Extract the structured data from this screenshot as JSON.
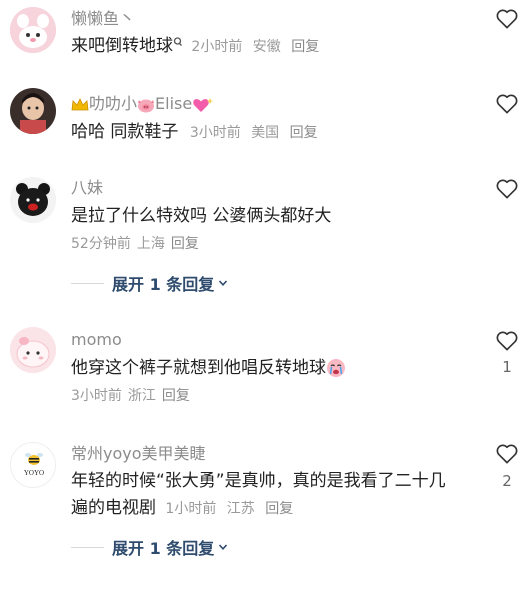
{
  "comments": [
    {
      "username": "懒懒鱼丶",
      "text": "来吧倒转地球",
      "time": "2小时前",
      "location": "安徽",
      "reply": "回复",
      "likes": ""
    },
    {
      "username_prefix": "叻叻小",
      "username_suffix": "Elise",
      "text": "哈哈 同款鞋子",
      "time": "3小时前",
      "location": "美国",
      "reply": "回复",
      "likes": ""
    },
    {
      "username": "八妹",
      "text": "是拉了什么特效吗 公婆俩头都好大",
      "time": "52分钟前",
      "location": "上海",
      "reply": "回复",
      "likes": "",
      "expand_label": "展开 1 条回复"
    },
    {
      "username": "momo",
      "text": "他穿这个裤子就想到他唱反转地球",
      "time": "3小时前",
      "location": "浙江",
      "reply": "回复",
      "likes": "1"
    },
    {
      "username": "常州yoyo美甲美睫",
      "text_line1": "年轻的时候“张大勇”是真帅，真的是我看了二十几",
      "text_line2": "遍的电视剧",
      "time": "1小时前",
      "location": "江苏",
      "reply": "回复",
      "likes": "2",
      "avatar_text": "YOYO",
      "expand_label": "展开 1 条回复"
    }
  ],
  "colors": {
    "username": "#8c8c8c",
    "meta": "#9a9a9a",
    "expand": "#2f4b6e",
    "heart": "#333333"
  },
  "icons": [
    "heart-outline-icon",
    "chevron-down-icon",
    "crown-emoji-icon",
    "pig-emoji-icon",
    "heart-sparkle-emoji-icon",
    "crying-face-emoji-icon",
    "location-pin-icon"
  ]
}
